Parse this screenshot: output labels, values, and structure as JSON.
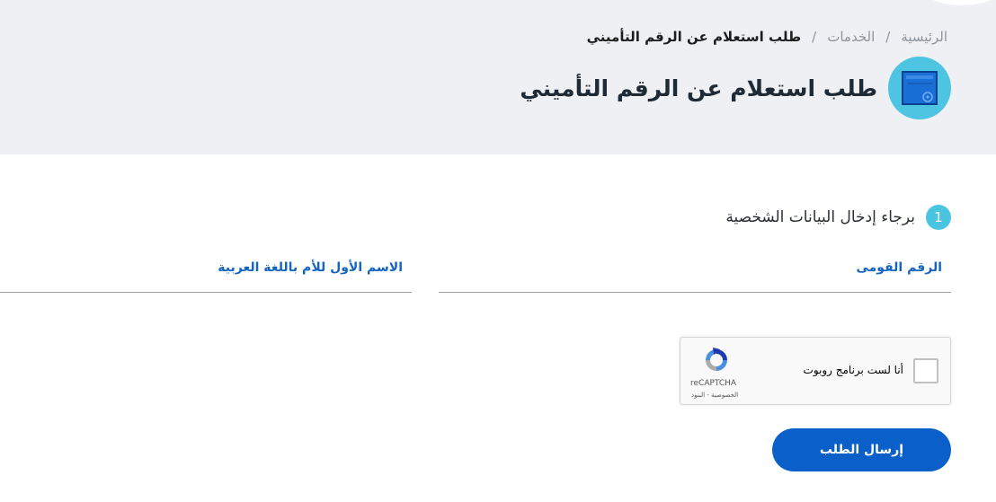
{
  "breadcrumb": {
    "home": "الرئيسية",
    "services": "الخدمات",
    "current": "طلب استعلام عن الرقم التأميني",
    "separator": "/"
  },
  "page": {
    "title": "طلب استعلام عن الرقم التأميني",
    "icon": "service-form-icon"
  },
  "step": {
    "number": "1",
    "title": "برجاء إدخال البيانات الشخصية"
  },
  "form": {
    "national_id_label": "الرقم القومى",
    "mother_name_label": "الاسم الأول للأم باللغة العربية",
    "national_id_value": "",
    "mother_name_value": ""
  },
  "recaptcha": {
    "label": "أنا لست برنامج روبوت",
    "brand": "reCAPTCHA",
    "terms": "الخصوصية - البنود",
    "icon": "recaptcha-logo-icon"
  },
  "actions": {
    "submit_label": "إرسال الطلب"
  },
  "colors": {
    "header_bg": "#eef0f3",
    "accent_cyan": "#4cc4e2",
    "primary_blue": "#0a5fc9",
    "label_blue": "#1565c0"
  }
}
